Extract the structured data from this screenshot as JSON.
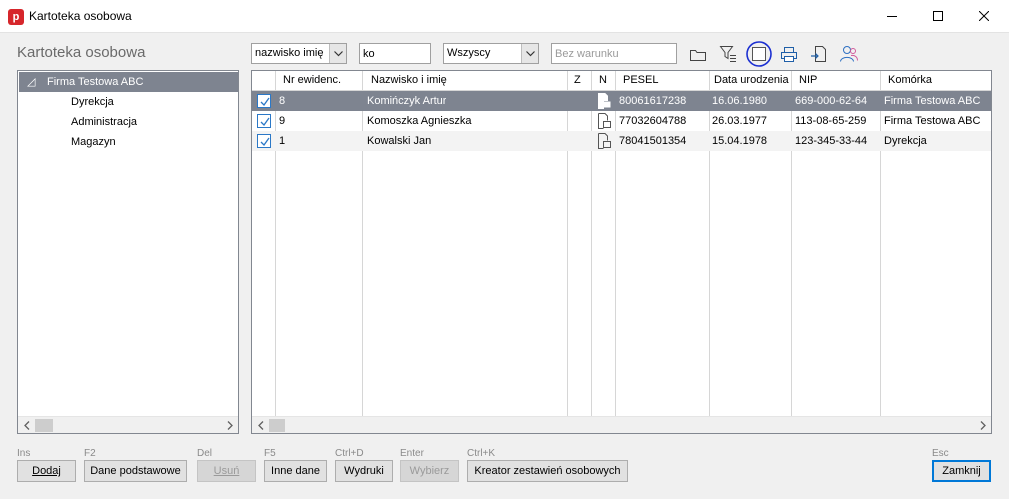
{
  "window": {
    "title": "Kartoteka osobowa",
    "app_icon_letter": "p"
  },
  "heading": "Kartoteka osobowa",
  "filters": {
    "field_combo": "nazwisko imię",
    "search_value": "ko",
    "scope_combo": "Wszyscy",
    "condition_placeholder": "Bez warunku"
  },
  "toolbar_icons": [
    "folder-icon",
    "filter-icon",
    "blank-square-icon",
    "print-icon",
    "export-icon",
    "people-icon"
  ],
  "tree": {
    "root": "Firma Testowa ABC",
    "root_expander": "◿",
    "children": [
      "Dyrekcja",
      "Administracja",
      "Magazyn"
    ]
  },
  "grid": {
    "columns": [
      "",
      "Nr ewidenc.",
      "Nazwisko i imię",
      "Z",
      "N",
      "PESEL",
      "Data urodzenia",
      "NIP",
      "Komórka"
    ],
    "rows": [
      {
        "checked": true,
        "nr": "8",
        "name": "Komińczyk Artur",
        "z": "",
        "pesel": "80061617238",
        "birth": "16.06.1980",
        "nip": "669-000-62-64",
        "unit": "Firma Testowa ABC"
      },
      {
        "checked": true,
        "nr": "9",
        "name": "Komoszka Agnieszka",
        "z": "",
        "pesel": "77032604788",
        "birth": "26.03.1977",
        "nip": "113-08-65-259",
        "unit": "Firma Testowa ABC"
      },
      {
        "checked": true,
        "nr": "1",
        "name": "Kowalski Jan",
        "z": "",
        "pesel": "78041501354",
        "birth": "15.04.1978",
        "nip": "123-345-33-44",
        "unit": "Dyrekcja"
      }
    ]
  },
  "buttons": {
    "add": {
      "hint": "Ins",
      "label": "Dodaj"
    },
    "basic": {
      "hint": "F2",
      "label": "Dane podstawowe"
    },
    "delete": {
      "hint": "Del",
      "label": "Usuń"
    },
    "other": {
      "hint": "F5",
      "label": "Inne dane"
    },
    "prints": {
      "hint": "Ctrl+D",
      "label": "Wydruki"
    },
    "choose": {
      "hint": "Enter",
      "label": "Wybierz"
    },
    "creator": {
      "hint": "Ctrl+K",
      "label": "Kreator zestawień osobowych"
    },
    "close": {
      "hint": "Esc",
      "label": "Zamknij"
    }
  },
  "colors": {
    "selection": "#7e8490",
    "accent_blue": "#0078d7",
    "highlight_circle": "#1b2fd1",
    "app_icon": "#d6262b"
  }
}
